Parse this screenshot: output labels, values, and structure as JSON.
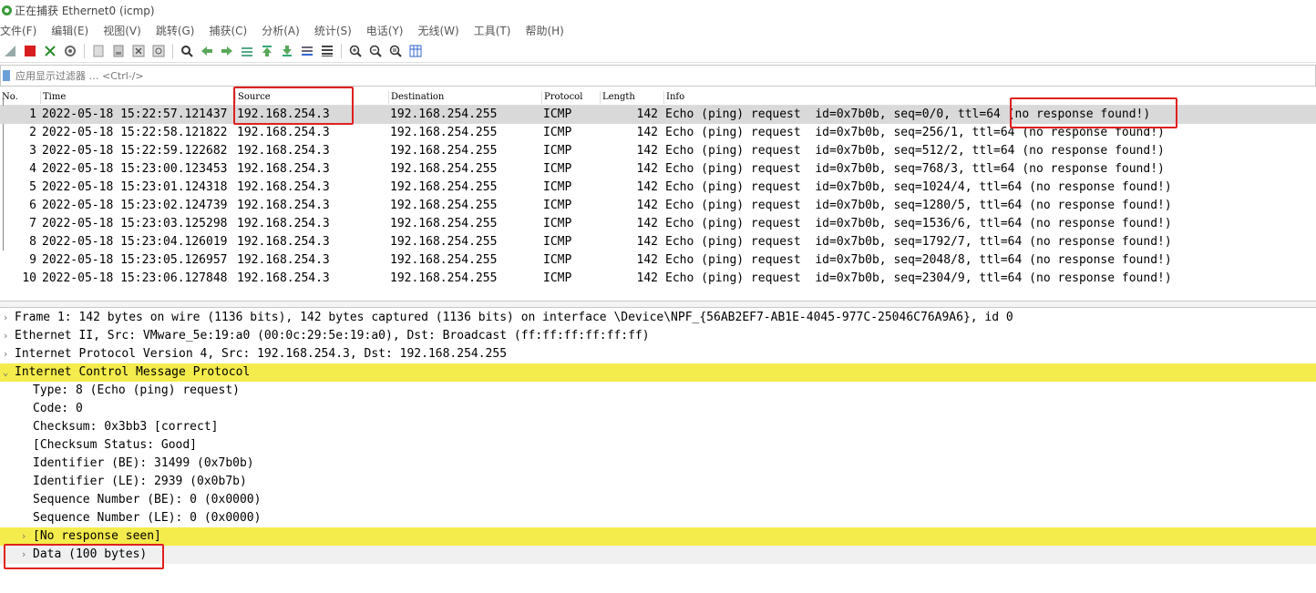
{
  "window": {
    "title": "正在捕获 Ethernet0 (icmp)"
  },
  "menu": [
    "文件(F)",
    "编辑(E)",
    "视图(V)",
    "跳转(G)",
    "捕获(C)",
    "分析(A)",
    "统计(S)",
    "电话(Y)",
    "无线(W)",
    "工具(T)",
    "帮助(H)"
  ],
  "filter": {
    "placeholder": "应用显示过滤器 … <Ctrl-/>"
  },
  "columns": {
    "no": "No.",
    "time": "Time",
    "source": "Source",
    "destination": "Destination",
    "protocol": "Protocol",
    "length": "Length",
    "info": "Info"
  },
  "packets": [
    {
      "no": "1",
      "time": "2022-05-18 15:22:57.121437",
      "source": "192.168.254.3",
      "destination": "192.168.254.255",
      "protocol": "ICMP",
      "length": "142",
      "info": "Echo (ping) request  id=0x7b0b, seq=0/0, ttl=64 (no response found!)"
    },
    {
      "no": "2",
      "time": "2022-05-18 15:22:58.121822",
      "source": "192.168.254.3",
      "destination": "192.168.254.255",
      "protocol": "ICMP",
      "length": "142",
      "info": "Echo (ping) request  id=0x7b0b, seq=256/1, ttl=64 (no response found!)"
    },
    {
      "no": "3",
      "time": "2022-05-18 15:22:59.122682",
      "source": "192.168.254.3",
      "destination": "192.168.254.255",
      "protocol": "ICMP",
      "length": "142",
      "info": "Echo (ping) request  id=0x7b0b, seq=512/2, ttl=64 (no response found!)"
    },
    {
      "no": "4",
      "time": "2022-05-18 15:23:00.123453",
      "source": "192.168.254.3",
      "destination": "192.168.254.255",
      "protocol": "ICMP",
      "length": "142",
      "info": "Echo (ping) request  id=0x7b0b, seq=768/3, ttl=64 (no response found!)"
    },
    {
      "no": "5",
      "time": "2022-05-18 15:23:01.124318",
      "source": "192.168.254.3",
      "destination": "192.168.254.255",
      "protocol": "ICMP",
      "length": "142",
      "info": "Echo (ping) request  id=0x7b0b, seq=1024/4, ttl=64 (no response found!)"
    },
    {
      "no": "6",
      "time": "2022-05-18 15:23:02.124739",
      "source": "192.168.254.3",
      "destination": "192.168.254.255",
      "protocol": "ICMP",
      "length": "142",
      "info": "Echo (ping) request  id=0x7b0b, seq=1280/5, ttl=64 (no response found!)"
    },
    {
      "no": "7",
      "time": "2022-05-18 15:23:03.125298",
      "source": "192.168.254.3",
      "destination": "192.168.254.255",
      "protocol": "ICMP",
      "length": "142",
      "info": "Echo (ping) request  id=0x7b0b, seq=1536/6, ttl=64 (no response found!)"
    },
    {
      "no": "8",
      "time": "2022-05-18 15:23:04.126019",
      "source": "192.168.254.3",
      "destination": "192.168.254.255",
      "protocol": "ICMP",
      "length": "142",
      "info": "Echo (ping) request  id=0x7b0b, seq=1792/7, ttl=64 (no response found!)"
    },
    {
      "no": "9",
      "time": "2022-05-18 15:23:05.126957",
      "source": "192.168.254.3",
      "destination": "192.168.254.255",
      "protocol": "ICMP",
      "length": "142",
      "info": "Echo (ping) request  id=0x7b0b, seq=2048/8, ttl=64 (no response found!)"
    },
    {
      "no": "10",
      "time": "2022-05-18 15:23:06.127848",
      "source": "192.168.254.3",
      "destination": "192.168.254.255",
      "protocol": "ICMP",
      "length": "142",
      "info": "Echo (ping) request  id=0x7b0b, seq=2304/9, ttl=64 (no response found!)"
    }
  ],
  "details": [
    {
      "text": "Frame 1: 142 bytes on wire (1136 bits), 142 bytes captured (1136 bits) on interface \\Device\\NPF_{56AB2EF7-AB1E-4045-977C-25046C76A9A6}, id 0",
      "indent": 0,
      "arrow": "›"
    },
    {
      "text": "Ethernet II, Src: VMware_5e:19:a0 (00:0c:29:5e:19:a0), Dst: Broadcast (ff:ff:ff:ff:ff:ff)",
      "indent": 0,
      "arrow": "›"
    },
    {
      "text": "Internet Protocol Version 4, Src: 192.168.254.3, Dst: 192.168.254.255",
      "indent": 0,
      "arrow": "›"
    },
    {
      "text": "Internet Control Message Protocol",
      "indent": 0,
      "arrow": "⌄",
      "highlight": true
    },
    {
      "text": "Type: 8 (Echo (ping) request)",
      "indent": 1
    },
    {
      "text": "Code: 0",
      "indent": 1
    },
    {
      "text": "Checksum: 0x3bb3 [correct]",
      "indent": 1
    },
    {
      "text": "[Checksum Status: Good]",
      "indent": 1
    },
    {
      "text": "Identifier (BE): 31499 (0x7b0b)",
      "indent": 1
    },
    {
      "text": "Identifier (LE): 2939 (0x0b7b)",
      "indent": 1
    },
    {
      "text": "Sequence Number (BE): 0 (0x0000)",
      "indent": 1
    },
    {
      "text": "Sequence Number (LE): 0 (0x0000)",
      "indent": 1
    },
    {
      "text": "[No response seen]",
      "indent": 1,
      "arrow": "›",
      "highlight": true
    },
    {
      "text": "Data (100 bytes)",
      "indent": 1,
      "arrow": "›",
      "gray": true
    }
  ]
}
